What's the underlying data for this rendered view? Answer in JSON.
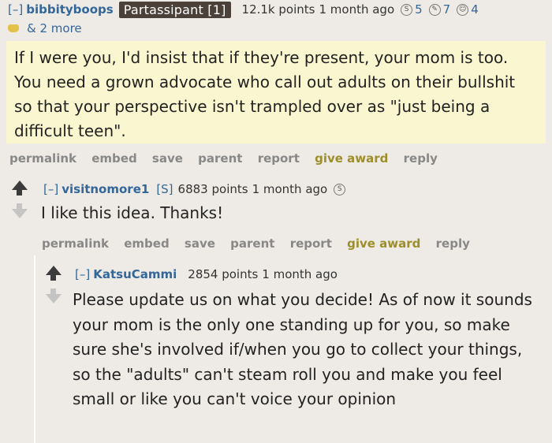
{
  "comment1": {
    "collapse": "[–]",
    "author": "bibbityboops",
    "flair": "Partassipant [1]",
    "points": "12.1k points",
    "time": "1 month ago",
    "awards": [
      {
        "icon": "silver-award-icon",
        "glyph": "S",
        "count": "5"
      },
      {
        "icon": "helpful-award-icon",
        "glyph": "✎",
        "count": "7"
      },
      {
        "icon": "wholesome-award-icon",
        "glyph": "☺",
        "count": "4"
      }
    ],
    "more_awards": "& 2 more",
    "body": "If I were you, I'd insist that if they're present, your mom is too. You need a grown advocate who call out adults on their bullshit so that your perspective isn't trampled over as \"just being a difficult teen\".",
    "links": [
      "permalink",
      "embed",
      "save",
      "parent",
      "report",
      "give award",
      "reply"
    ]
  },
  "comment2": {
    "collapse": "[–]",
    "author": "visitnomore1",
    "op_tag": "[S]",
    "points": "6883 points",
    "time": "1 month ago",
    "award_glyph": "S",
    "body": "I like this idea. Thanks!",
    "links": [
      "permalink",
      "embed",
      "save",
      "parent",
      "report",
      "give award",
      "reply"
    ]
  },
  "comment3": {
    "collapse": "[–]",
    "author": "KatsuCammi",
    "points": "2854 points",
    "time": "1 month ago",
    "body": "Please update us on what you decide! As of now it sounds your mom is the only one standing up for you, so make sure she's involved if/when you go to collect your things, so the \"adults\" can't steam roll you and make you feel small or like you can't voice your opinion"
  },
  "colors": {
    "background": "#eeebe6",
    "link_blue": "#336699",
    "flair_bg": "#4b4139",
    "highlight_bg": "#faf6cf",
    "give_award": "#9c8e2a"
  }
}
